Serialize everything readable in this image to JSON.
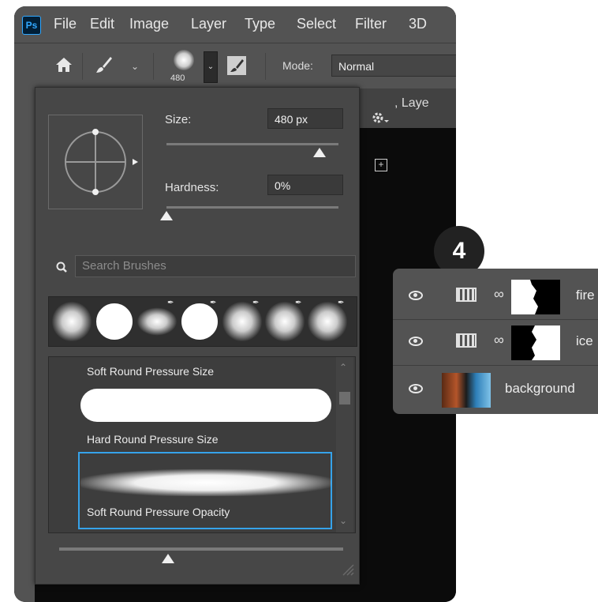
{
  "app": {
    "logo": "Ps",
    "menu": [
      "File",
      "Edit",
      "Image",
      "Layer",
      "Type",
      "Select",
      "Filter",
      "3D"
    ]
  },
  "options_bar": {
    "brush_size": "480",
    "mode_label": "Mode:",
    "mode_value": "Normal"
  },
  "document_tab": {
    "title_fragment": ", Laye"
  },
  "brush_panel": {
    "size_label": "Size:",
    "size_value": "480 px",
    "size_level": 0.88,
    "hardness_label": "Hardness:",
    "hardness_value": "0%",
    "hardness_level": 0.0,
    "search_placeholder": "Search Brushes",
    "presets": [
      "soft",
      "hard",
      "soft",
      "hard",
      "soft",
      "soft",
      "soft"
    ],
    "brush_list": [
      {
        "label": "Soft Round Pressure Size"
      },
      {
        "label": "Hard Round Pressure Size"
      },
      {
        "label": "Soft Round Pressure Opacity",
        "selected": true
      }
    ]
  },
  "callout": {
    "number": "4"
  },
  "layers": [
    {
      "name": "fire",
      "visible": true
    },
    {
      "name": "ice",
      "visible": true
    },
    {
      "name": "background",
      "visible": true
    }
  ],
  "colors": {
    "panel": "#474747",
    "selection": "#36a3ea",
    "menubar": "#535353"
  }
}
